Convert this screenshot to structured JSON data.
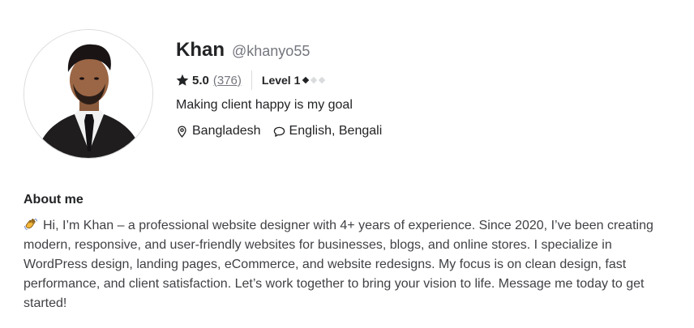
{
  "profile": {
    "name": "Khan",
    "username": "@khanyo55",
    "rating": "5.0",
    "review_count": "(376)",
    "level": "Level 1",
    "level_progress": 1,
    "level_max": 3,
    "tagline": "Making client happy is my goal",
    "location": "Bangladesh",
    "languages": "English, Bengali"
  },
  "about": {
    "title": "About me",
    "emoji_icon": "waving-hand-icon",
    "text": "Hi, I’m Khan – a professional website designer with 4+ years of experience. Since 2020, I’ve been creating modern, responsive, and user-friendly websites for businesses, blogs, and online stores. I specialize in WordPress design, landing pages, eCommerce, and website redesigns. My focus is on clean design, fast performance, and client satisfaction. Let’s work together to bring your vision to life. Message me today to get started!"
  },
  "icons": {
    "star": "star-icon",
    "location": "location-pin-icon",
    "language": "speech-bubble-icon"
  },
  "colors": {
    "text": "#222325",
    "muted": "#74767e",
    "divider": "#dadbdd",
    "level_filled": "#222325",
    "level_empty": "#dadbdd"
  }
}
